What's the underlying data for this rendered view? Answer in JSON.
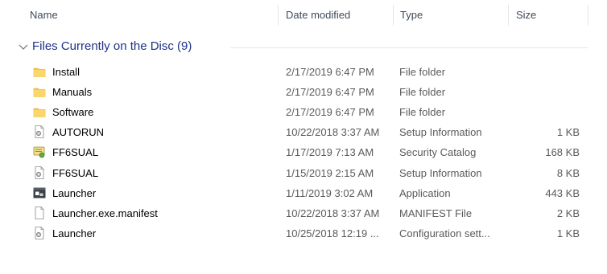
{
  "columns": {
    "name": "Name",
    "date_modified": "Date modified",
    "type": "Type",
    "size": "Size"
  },
  "group": {
    "title": "Files Currently on the Disc (9)",
    "expanded": true
  },
  "files": [
    {
      "name": "Install",
      "date": "2/17/2019 6:47 PM",
      "type": "File folder",
      "size": "",
      "icon": "folder-icon"
    },
    {
      "name": "Manuals",
      "date": "2/17/2019 6:47 PM",
      "type": "File folder",
      "size": "",
      "icon": "folder-icon"
    },
    {
      "name": "Software",
      "date": "2/17/2019 6:47 PM",
      "type": "File folder",
      "size": "",
      "icon": "folder-icon"
    },
    {
      "name": "AUTORUN",
      "date": "10/22/2018 3:37 AM",
      "type": "Setup Information",
      "size": "1 KB",
      "icon": "setup-file-icon"
    },
    {
      "name": "FF6SUAL",
      "date": "1/17/2019 7:13 AM",
      "type": "Security Catalog",
      "size": "168 KB",
      "icon": "security-catalog-icon"
    },
    {
      "name": "FF6SUAL",
      "date": "1/15/2019 2:15 AM",
      "type": "Setup Information",
      "size": "8 KB",
      "icon": "setup-file-icon"
    },
    {
      "name": "Launcher",
      "date": "1/11/2019 3:02 AM",
      "type": "Application",
      "size": "443 KB",
      "icon": "application-icon"
    },
    {
      "name": "Launcher.exe.manifest",
      "date": "10/22/2018 3:37 AM",
      "type": "MANIFEST File",
      "size": "2 KB",
      "icon": "blank-file-icon"
    },
    {
      "name": "Launcher",
      "date": "10/25/2018 12:19 ...",
      "type": "Configuration sett...",
      "size": "1 KB",
      "icon": "setup-file-icon"
    }
  ],
  "colors": {
    "group_title": "#1e3287",
    "folder": "#f7c848",
    "header_text": "#3e4a5a",
    "detail_text": "#5a5a5a"
  }
}
